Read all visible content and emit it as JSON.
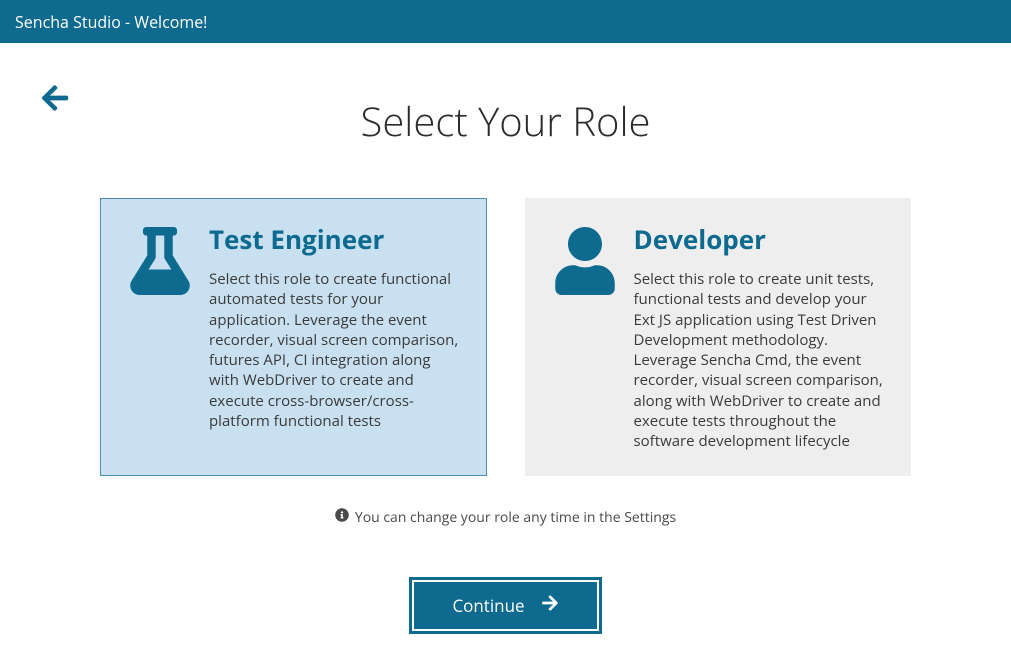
{
  "titlebar": "Sencha Studio - Welcome!",
  "page_title": "Select Your Role",
  "cards": {
    "test_engineer": {
      "title": "Test Engineer",
      "desc": "Select this role to create functional automated tests for your application. Leverage the event recorder, visual screen comparison, futures API, CI integration along with WebDriver to create and execute cross-browser/cross-platform functional tests"
    },
    "developer": {
      "title": "Developer",
      "desc": "Select this role to create unit tests, functional tests and develop your Ext JS application using Test Driven Development methodology. Leverage Sencha Cmd, the event recorder, visual screen comparison, along with WebDriver to create and execute tests throughout the software development lifecycle"
    }
  },
  "note": "You can change your role any time in the Settings",
  "continue_label": "Continue",
  "selected_role": "test_engineer",
  "colors": {
    "primary": "#0e6a8f",
    "selected_bg": "#c8e0f0",
    "unselected_bg": "#eeeeee"
  }
}
